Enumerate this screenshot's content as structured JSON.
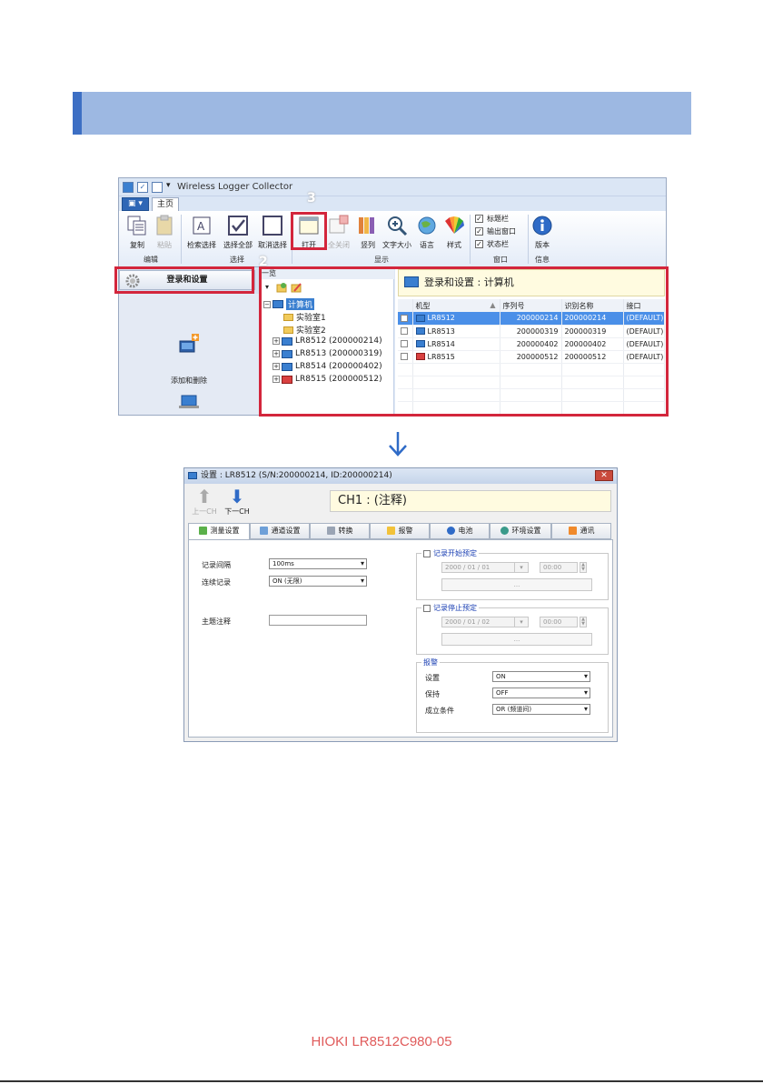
{
  "app": {
    "title": "Wireless Logger Collector",
    "tab_home": "主页",
    "ribbon": {
      "copy": "复制",
      "paste": "粘贴",
      "group_edit": "编辑",
      "search_select": "检索选择",
      "select_all": "选择全部",
      "cancel_select": "取消选择",
      "group_select": "选择",
      "open": "打开",
      "close_all": "全关闭",
      "columns": "竖列",
      "font_size": "文字大小",
      "language": "语言",
      "style": "样式",
      "group_display": "显示",
      "title_bar": "标题栏",
      "output_window": "输出窗口",
      "status_bar": "状态栏",
      "group_window": "窗口",
      "version": "版本",
      "group_info": "信息"
    },
    "left_panel": {
      "login_settings": "登录和设置",
      "add_delete": "添加和删除"
    },
    "tree": {
      "header": "一览",
      "root": "计算机",
      "items": [
        "实验室1",
        "实验室2",
        "LR8512 (200000214)",
        "LR8513 (200000319)",
        "LR8514 (200000402)",
        "LR8515 (200000512)"
      ]
    },
    "right_panel": {
      "header": "登录和设置 : 计算机",
      "columns": [
        "机型",
        "序列号",
        "识别名称",
        "接口"
      ],
      "rows": [
        [
          "LR8512",
          "200000214",
          "200000214",
          "(DEFAULT)"
        ],
        [
          "LR8513",
          "200000319",
          "200000319",
          "(DEFAULT)"
        ],
        [
          "LR8514",
          "200000402",
          "200000402",
          "(DEFAULT)"
        ],
        [
          "LR8515",
          "200000512",
          "200000512",
          "(DEFAULT)"
        ]
      ]
    },
    "steps": [
      "2",
      "3"
    ]
  },
  "dialog": {
    "title": "设置 : LR8512 (S/N:200000214, ID:200000214)",
    "prev_ch": "上一CH",
    "next_ch": "下一CH",
    "ch_label": "CH1 : (注释)",
    "tabs": [
      "测量设置",
      "通道设置",
      "转换",
      "报警",
      "电池",
      "环境设置",
      "通讯"
    ],
    "record_interval_label": "记录间隔",
    "record_interval_value": "100ms",
    "continuous_label": "连续记录",
    "continuous_value": "ON (无限)",
    "title_comment_label": "主题注释",
    "start_reserve_label": "记录开始预定",
    "start_date": "2000 / 01 / 01",
    "start_time": "00:00",
    "stop_reserve_label": "记录停止预定",
    "stop_date": "2000 / 01 / 02",
    "stop_time": "00:00",
    "dots": "...",
    "alarm_group": "报警",
    "alarm_setting_label": "设置",
    "alarm_setting_value": "ON",
    "alarm_hold_label": "保持",
    "alarm_hold_value": "OFF",
    "alarm_condition_label": "成立条件",
    "alarm_condition_value": "OR (频道间)"
  },
  "footer": "HIOKI LR8512C980-05"
}
